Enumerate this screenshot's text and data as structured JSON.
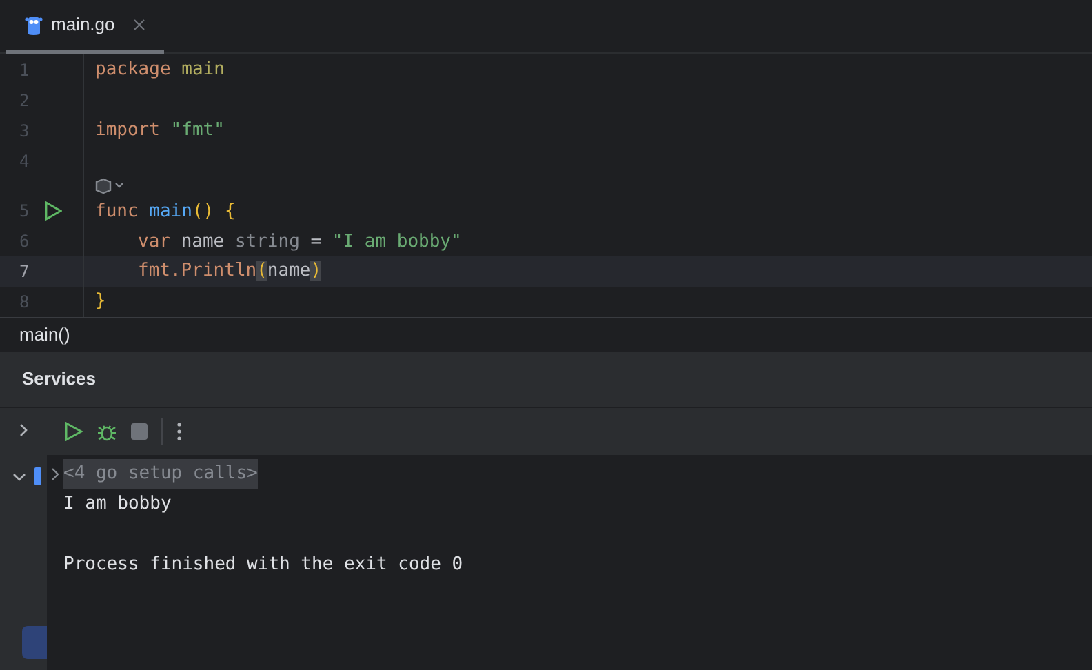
{
  "tabs": [
    {
      "label": "main.go",
      "selected": true,
      "closable": true
    }
  ],
  "editor": {
    "lines": [
      {
        "number": "1",
        "tokens": [
          {
            "text": "package",
            "kind": "keyword"
          },
          {
            "text": "main",
            "kind": "package"
          }
        ]
      },
      {
        "number": "2"
      },
      {
        "number": "3",
        "tokens": [
          {
            "text": "import",
            "kind": "keyword"
          },
          {
            "text": "\"fmt\"",
            "kind": "string"
          }
        ]
      },
      {
        "number": "4",
        "hint_after": true
      },
      {
        "number": "5",
        "run": true,
        "tokens": [
          {
            "text": "func",
            "kind": "keyword"
          },
          {
            "text": "main",
            "kind": "function"
          },
          {
            "text": "()",
            "kind": "brace",
            "attached": true
          },
          {
            "text": "{",
            "kind": "brace"
          }
        ]
      },
      {
        "number": "6",
        "indented": true,
        "tokens": [
          {
            "text": "var",
            "kind": "keyword"
          },
          {
            "text": "name",
            "kind": "ident"
          },
          {
            "text": "string",
            "kind": "type"
          },
          {
            "text": "=",
            "kind": "operator"
          },
          {
            "text": "\"I am bobby\"",
            "kind": "string"
          }
        ]
      },
      {
        "number": "7",
        "current": true,
        "indented": true,
        "tokens": [
          {
            "text": "fmt.Println",
            "kind": "call"
          },
          {
            "text": "(",
            "kind": "match",
            "attached": true
          },
          {
            "text": "name",
            "kind": "ident",
            "attached": true
          },
          {
            "text": ")",
            "kind": "match",
            "attached": true
          }
        ]
      },
      {
        "number": "8",
        "tokens": [
          {
            "text": "}",
            "kind": "brace"
          }
        ]
      }
    ]
  },
  "breadcrumb": "main()",
  "services": {
    "title": "Services",
    "console": [
      {
        "text": "<4 go setup calls>",
        "kind": "folded"
      },
      {
        "text": "I am bobby",
        "kind": "output"
      },
      {
        "text": "Process finished with the exit code 0",
        "kind": "output",
        "gap_before": true
      }
    ]
  }
}
